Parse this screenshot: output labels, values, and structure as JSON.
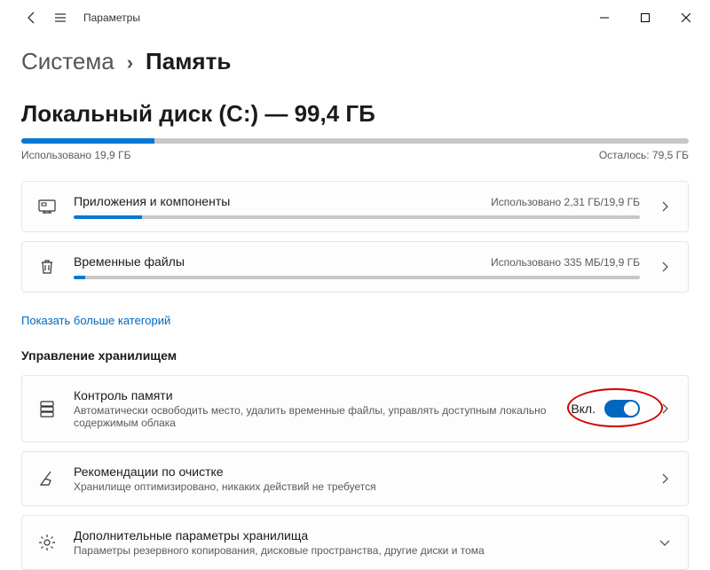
{
  "titlebar": {
    "title": "Параметры"
  },
  "breadcrumb": {
    "parent": "Система",
    "sep": "›",
    "current": "Память"
  },
  "disk": {
    "title": "Локальный диск (C:) — 99,4 ГБ",
    "used_label": "Использовано 19,9 ГБ",
    "free_label": "Осталось: 79,5 ГБ",
    "used_pct": 20
  },
  "cards": {
    "apps": {
      "title": "Приложения и компоненты",
      "usage": "Использовано 2,31 ГБ/19,9 ГБ",
      "pct": 12
    },
    "temp": {
      "title": "Временные файлы",
      "usage": "Использовано 335 МБ/19,9 ГБ",
      "pct": 2
    }
  },
  "link_more": "Показать больше категорий",
  "section_manage": "Управление хранилищем",
  "sense": {
    "title": "Контроль памяти",
    "sub": "Автоматически освободить место, удалить временные файлы, управлять доступным локально содержимым облака",
    "state": "Вкл."
  },
  "clean": {
    "title": "Рекомендации по очистке",
    "sub": "Хранилище оптимизировано, никаких действий не требуется"
  },
  "adv": {
    "title": "Дополнительные параметры хранилища",
    "sub": "Параметры резервного копирования, дисковые пространства, другие диски и тома"
  }
}
